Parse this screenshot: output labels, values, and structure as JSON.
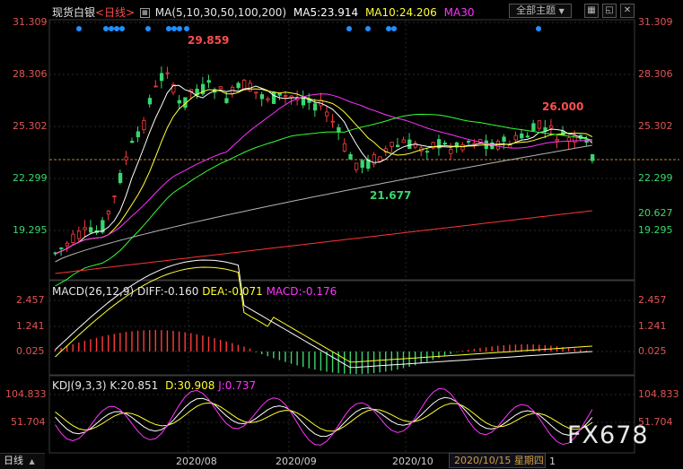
{
  "header": {
    "symbol": "现货白银",
    "period_label": "<日线>",
    "ma_label": "MA(5,10,30,50,100,200)",
    "ma5": "MA5:23.914",
    "ma10": "MA10:24.206",
    "ma30": "MA30",
    "theme_dropdown": "全部主题",
    "theme_dropdown_arrow": "▼"
  },
  "price_panel": {
    "axis_left": [
      "31.309",
      "28.306",
      "25.302",
      "22.299",
      "19.295"
    ],
    "axis_right": [
      "31.309",
      "28.306",
      "25.302",
      "22.299",
      "19.295"
    ],
    "current_price_tag": "20.627",
    "annotations": {
      "high": "29.859",
      "low": "21.677",
      "recent_high": "26.000"
    }
  },
  "macd_panel": {
    "title": "MACD(26,12,9)",
    "diff": "DIFF:-0.160",
    "dea": "DEA:-0.071",
    "macd": "MACD:-0.176",
    "axis_left": [
      "2.457",
      "1.241",
      "0.025"
    ],
    "axis_right": [
      "2.457",
      "1.241",
      "0.025"
    ]
  },
  "kdj_panel": {
    "title": "KDJ(9,3,3)",
    "k": "K:20.851",
    "d": "D:30.908",
    "j": "J:0.737",
    "axis_left": [
      "104.833",
      "51.704"
    ],
    "axis_right": [
      "104.833",
      "51.704"
    ]
  },
  "footer": {
    "period_tab": "日线",
    "dates": [
      "2020/08",
      "2020/09",
      "2020/10"
    ],
    "cursor_date": "2020/10/15 星期四",
    "cursor_suffix": "1"
  },
  "watermark": "FX678",
  "colors": {
    "up": "#ff3b3b",
    "down": "#3ad66e",
    "ma5": "#ffffff",
    "ma10": "#ffff33",
    "ma30": "#ff33ff",
    "ma50": "#33ff33",
    "ma100": "#b4b4b4",
    "ma200": "#ff3333",
    "dots": "#1e90ff"
  }
}
